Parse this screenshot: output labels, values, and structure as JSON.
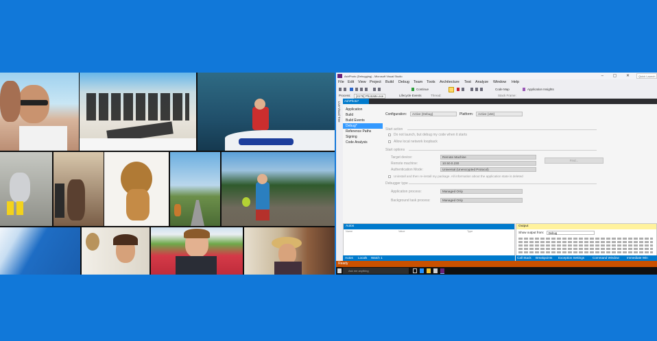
{
  "visual_studio": {
    "title_bar": {
      "title": "AshPhoto (Debugging) - Microsoft Visual Studio",
      "controls": "– ▢ ✕",
      "quick_launch_placeholder": "Quick Launch"
    },
    "menu": [
      "File",
      "Edit",
      "View",
      "Project",
      "Build",
      "Debug",
      "Team",
      "Tools",
      "Architecture",
      "Test",
      "Analyze",
      "Window",
      "Help"
    ],
    "toolbar": {
      "continue": "Continue",
      "code_map": "Code Map",
      "app_insights": "Application Insights"
    },
    "debug_location": {
      "process_label": "Process:",
      "process_value": "[4176] PhotoMe.exe",
      "lifecycle": "Lifecycle Events",
      "thread": "Thread:",
      "stack_frame": "Stack Frame:"
    },
    "doc_tab": "AshPhoto*",
    "side_strip": "Live Visual Tree",
    "nav_items": [
      "Application",
      "Build",
      "Build Events",
      "Debug*",
      "Reference Paths",
      "Signing",
      "Code Analysis"
    ],
    "props": {
      "configuration_label": "Configuration:",
      "configuration_value": "Active (Debug)",
      "platform_label": "Platform:",
      "platform_value": "Active (x64)",
      "start_action": "Start action",
      "do_not_launch": "Do not launch, but debug my code when it starts",
      "allow_loopback": "Allow local network loopback",
      "start_options": "Start options",
      "target_device_label": "Target device:",
      "target_device_value": "Remote Machine",
      "remote_machine_label": "Remote machine:",
      "remote_machine_value": "10.50.0.230",
      "find_button": "Find...",
      "auth_mode_label": "Authentication Mode:",
      "auth_mode_value": "Universal (Unencrypted Protocol)",
      "uninstall_note": "Uninstall and then re-install my package. All information about the application state is deleted",
      "debugger_type": "Debugger type",
      "app_process_label": "Application process:",
      "app_process_value": "Managed Only",
      "bg_task_label": "Background task process:",
      "bg_task_value": "Managed Only"
    },
    "autos": {
      "title": "Autos",
      "columns": [
        "Name",
        "Value",
        "Type"
      ],
      "tabs": [
        "Autos",
        "Locals",
        "Watch 1"
      ]
    },
    "output": {
      "title": "Output",
      "show_from_label": "Show output from:",
      "show_from_value": "Debug",
      "tabs": [
        "Call Stack",
        "Breakpoints",
        "Exception Settings",
        "Command Window",
        "Immediate Win"
      ]
    },
    "status": "Ready",
    "taskbar_search": "Ask me anything"
  },
  "colors": {
    "background": "#1178d9",
    "vs_accent": "#007acc",
    "status_debug": "#ca5100",
    "output_header": "#fff29d"
  }
}
